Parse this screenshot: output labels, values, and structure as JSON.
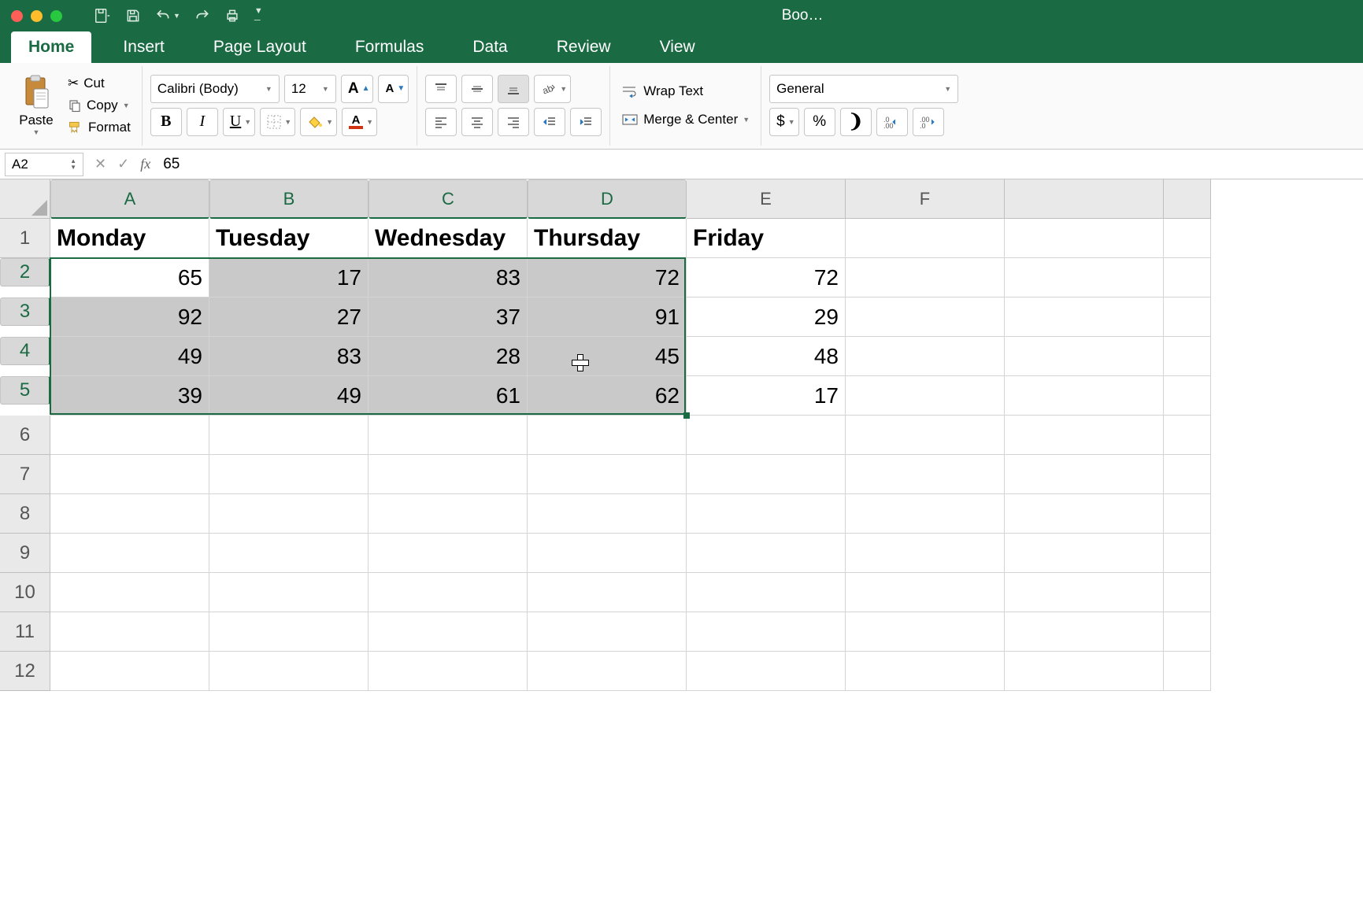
{
  "window": {
    "title": "Boo…"
  },
  "tabs": [
    "Home",
    "Insert",
    "Page Layout",
    "Formulas",
    "Data",
    "Review",
    "View"
  ],
  "active_tab": "Home",
  "clipboard": {
    "paste": "Paste",
    "cut": "Cut",
    "copy": "Copy",
    "format": "Format"
  },
  "font": {
    "name": "Calibri (Body)",
    "size": "12"
  },
  "alignment": {
    "wrap": "Wrap Text",
    "merge": "Merge & Center"
  },
  "number": {
    "format": "General"
  },
  "namebox": "A2",
  "formula": "65",
  "columns": [
    "A",
    "B",
    "C",
    "D",
    "E",
    "F"
  ],
  "rows": [
    1,
    2,
    3,
    4,
    5,
    6,
    7,
    8,
    9,
    10,
    11,
    12
  ],
  "selected_cols": [
    "A",
    "B",
    "C",
    "D"
  ],
  "selected_rows": [
    2,
    3,
    4,
    5
  ],
  "active_cell": "A2",
  "chart_data": {
    "type": "table",
    "headers": [
      "Monday",
      "Tuesday",
      "Wednesday",
      "Thursday",
      "Friday"
    ],
    "data": [
      [
        65,
        17,
        83,
        72,
        72
      ],
      [
        92,
        27,
        37,
        91,
        29
      ],
      [
        49,
        83,
        28,
        45,
        48
      ],
      [
        39,
        49,
        61,
        62,
        17
      ]
    ]
  },
  "cells": {
    "A1": "Monday",
    "B1": "Tuesday",
    "C1": "Wednesday",
    "D1": "Thursday",
    "E1": "Friday",
    "A2": "65",
    "B2": "17",
    "C2": "83",
    "D2": "72",
    "E2": "72",
    "A3": "92",
    "B3": "27",
    "C3": "37",
    "D3": "91",
    "E3": "29",
    "A4": "49",
    "B4": "83",
    "C4": "28",
    "D4": "45",
    "E4": "48",
    "A5": "39",
    "B5": "49",
    "C5": "61",
    "D5": "62",
    "E5": "17"
  }
}
